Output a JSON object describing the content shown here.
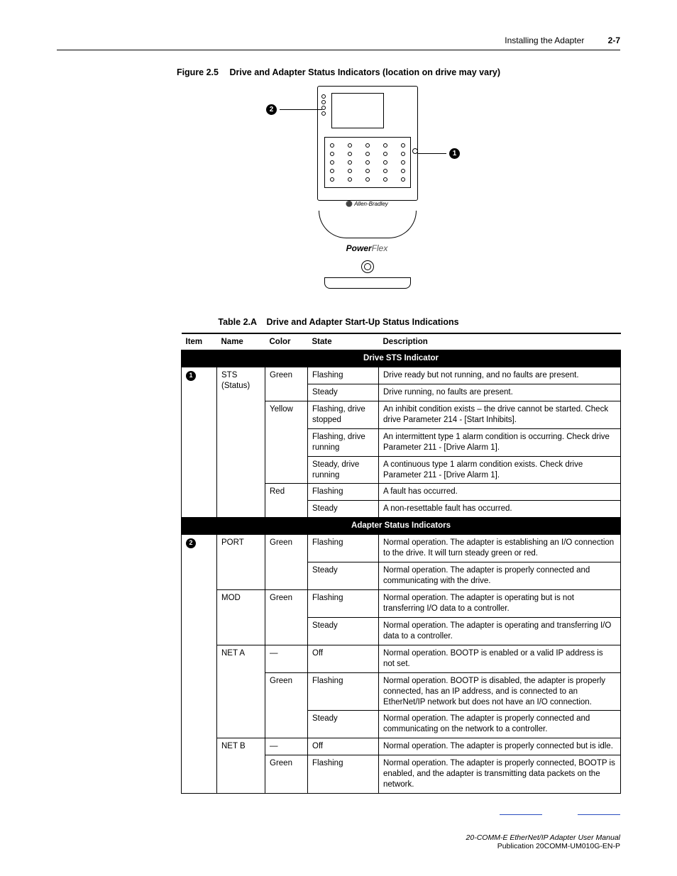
{
  "header": {
    "section": "Installing the Adapter",
    "page": "2-7"
  },
  "figure": {
    "num": "Figure 2.5",
    "title": "Drive and Adapter Status Indicators (location on drive may vary)",
    "brand_logo": "Allen-Bradley",
    "product_p": "Power",
    "product_f": "Flex",
    "callout1": "1",
    "callout2": "2"
  },
  "table": {
    "num": "Table 2.A",
    "title": "Drive and Adapter Start-Up Status Indications",
    "headers": {
      "item": "Item",
      "name": "Name",
      "color": "Color",
      "state": "State",
      "desc": "Description"
    },
    "section1": "Drive STS Indicator",
    "section2": "Adapter Status Indicators",
    "rows": [
      {
        "item": "1",
        "name": "STS (Status)",
        "color": "Green",
        "state": "Flashing",
        "desc": "Drive ready but not running, and no faults are present."
      },
      {
        "item": "",
        "name": "",
        "color": "",
        "state": "Steady",
        "desc": "Drive running, no faults are present."
      },
      {
        "item": "",
        "name": "",
        "color": "Yellow",
        "state": "Flashing, drive stopped",
        "desc": "An inhibit condition exists – the drive cannot be started. Check drive Parameter 214 - [Start Inhibits]."
      },
      {
        "item": "",
        "name": "",
        "color": "",
        "state": "Flashing, drive running",
        "desc": "An intermittent type 1 alarm condition is occurring. Check drive Parameter 211 - [Drive Alarm 1]."
      },
      {
        "item": "",
        "name": "",
        "color": "",
        "state": "Steady, drive running",
        "desc": "A continuous type 1 alarm condition exists. Check drive Parameter 211 - [Drive Alarm 1]."
      },
      {
        "item": "",
        "name": "",
        "color": "Red",
        "state": "Flashing",
        "desc": "A fault has occurred."
      },
      {
        "item": "",
        "name": "",
        "color": "",
        "state": "Steady",
        "desc": "A non-resettable fault has occurred."
      }
    ],
    "rows2": [
      {
        "item": "2",
        "name": "PORT",
        "color": "Green",
        "state": "Flashing",
        "desc": "Normal operation. The adapter is establishing an I/O connection to the drive. It will turn steady green or red."
      },
      {
        "item": "",
        "name": "",
        "color": "",
        "state": "Steady",
        "desc": "Normal operation. The adapter is properly connected and communicating with the drive."
      },
      {
        "item": "",
        "name": "MOD",
        "color": "Green",
        "state": "Flashing",
        "desc": "Normal operation. The adapter is operating but is not transferring I/O data to a controller."
      },
      {
        "item": "",
        "name": "",
        "color": "",
        "state": "Steady",
        "desc": "Normal operation. The adapter is operating and transferring I/O data to a controller."
      },
      {
        "item": "",
        "name": "NET A",
        "color": "—",
        "state": "Off",
        "desc": "Normal operation. BOOTP is enabled or a valid IP address is not set."
      },
      {
        "item": "",
        "name": "",
        "color": "Green",
        "state": "Flashing",
        "desc": "Normal operation. BOOTP is disabled, the adapter is properly connected, has an IP address, and is connected to an EtherNet/IP network but does not have an I/O connection."
      },
      {
        "item": "",
        "name": "",
        "color": "",
        "state": "Steady",
        "desc": "Normal operation. The adapter is properly connected and communicating on the network to a controller."
      },
      {
        "item": "",
        "name": "NET B",
        "color": "—",
        "state": "Off",
        "desc": "Normal operation. The adapter is properly connected but is idle."
      },
      {
        "item": "",
        "name": "",
        "color": "Green",
        "state": "Flashing",
        "desc": "Normal operation. The adapter is properly connected, BOOTP is enabled, and the adapter is transmitting data packets on the network."
      }
    ]
  },
  "footer": {
    "line1": "20-COMM-E EtherNet/IP Adapter User Manual",
    "line2": "Publication 20COMM-UM010G-EN-P"
  }
}
